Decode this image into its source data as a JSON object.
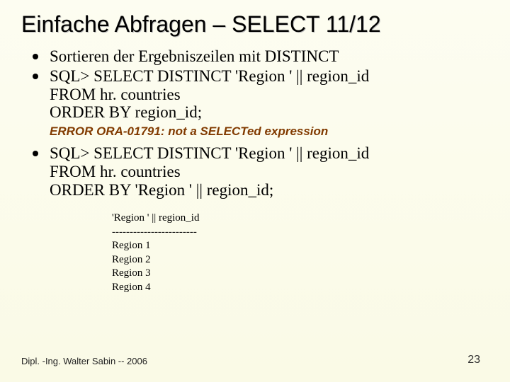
{
  "title": "Einfache Abfragen – SELECT 11/12",
  "bullets": {
    "b1": "Sortieren der Ergebniszeilen mit DISTINCT",
    "b2_l1": "SQL> SELECT DISTINCT 'Region ' || region_id",
    "b2_l2": "FROM hr. countries",
    "b2_l3": "ORDER BY region_id;",
    "b3_l1": "SQL> SELECT DISTINCT 'Region ' || region_id",
    "b3_l2": "FROM hr. countries",
    "b3_l3": "ORDER BY 'Region ' || region_id;"
  },
  "error_text": "ERROR  ORA-01791: not a SELECTed expression",
  "result": {
    "hdr": "'Region ' || region_id",
    "sep": "------------------------",
    "r1": "Region 1",
    "r2": "Region 2",
    "r3": "Region 3",
    "r4": "Region 4"
  },
  "footer": "Dipl. -Ing. Walter Sabin  -- 2006",
  "page": "23"
}
